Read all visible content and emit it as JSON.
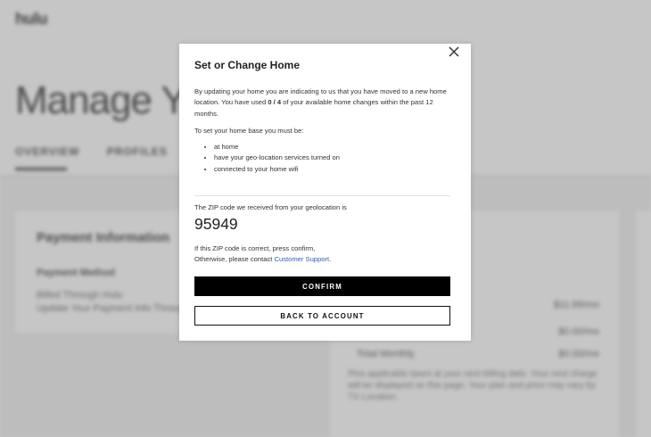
{
  "background": {
    "logo": "hulu",
    "hero": "Manage You",
    "tabs": [
      "OVERVIEW",
      "PROFILES"
    ],
    "payment_card": {
      "title": "Payment Information",
      "subtitle": "Payment Method",
      "lines": [
        "Billed Through Hulu",
        "Update Your Payment Info Through Hulu"
      ]
    },
    "plan_card": {
      "prices": [
        "$11.99/mo",
        "$0.00/mo",
        "$0.00/mo"
      ],
      "label": "Total Monthly",
      "description": "Plus applicable taxes at your next billing date. Your next charge will be displayed on this page. Your plan and price may vary by TV Location."
    }
  },
  "modal": {
    "title": "Set or Change Home",
    "para1_prefix": "By updating your home you are indicating to us that you have moved to a new home location. You have used ",
    "used_count": "0 / 4",
    "para1_suffix": " of your available home changes within the past 12 months.",
    "para2": "To set your home base you must be:",
    "requirements": [
      "at home",
      "have your geo-location services turned on",
      "connected to your home wifi"
    ],
    "zip_label": "The ZIP code we received from your geolocation is",
    "zip": "95949",
    "confirm_line1": "If this ZIP code is correct, press confirm,",
    "confirm_line2_prefix": "Otherwise, please contact ",
    "support_link": "Customer Support",
    "confirm_line2_suffix": ".",
    "confirm_button": "CONFIRM",
    "back_button": "BACK TO ACCOUNT",
    "close_icon": "close-icon"
  }
}
